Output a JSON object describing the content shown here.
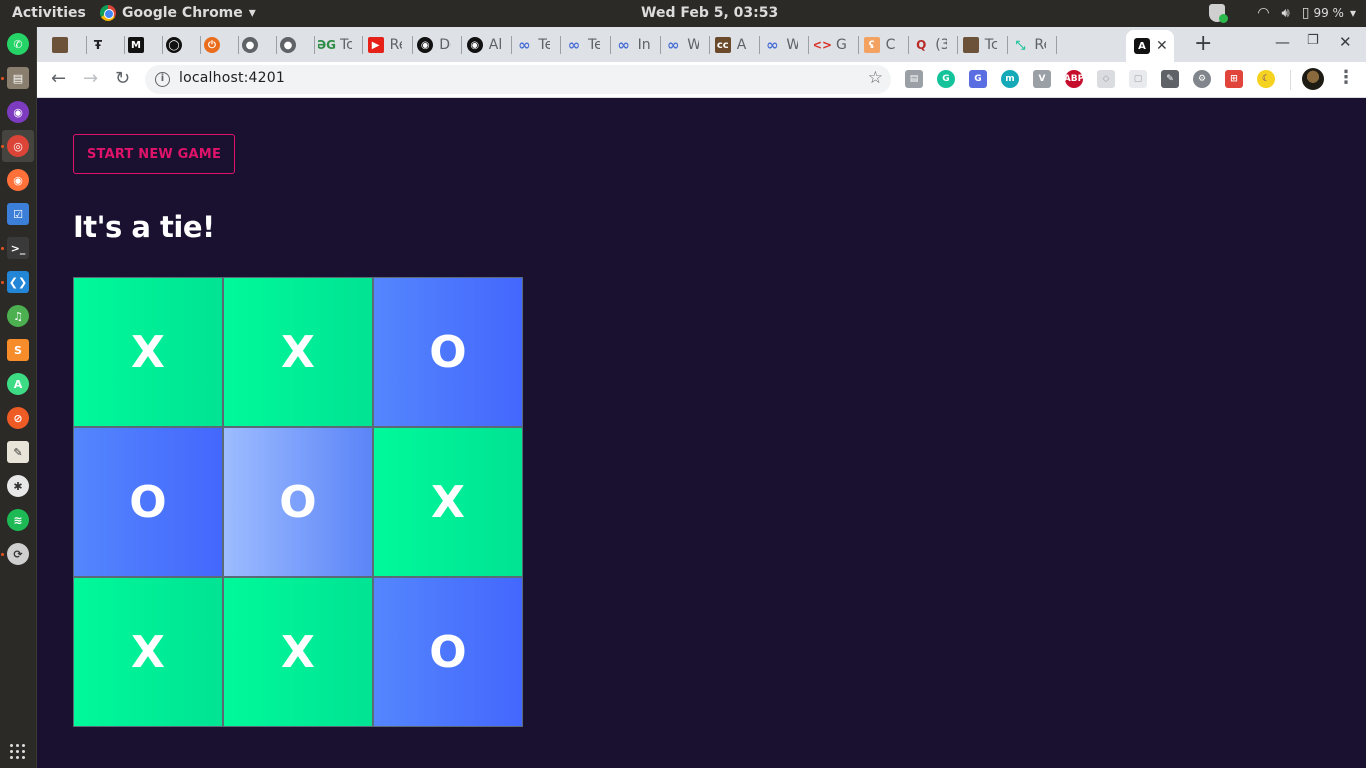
{
  "os": {
    "activities_label": "Activities",
    "app_menu_label": "Google Chrome",
    "app_menu_arrow": "▾",
    "clock": "Wed Feb  5, 03:53",
    "battery": "99 %",
    "tray_arrow": "▾",
    "dock": [
      {
        "name": "whatsapp",
        "color": "#25d366",
        "glyph": "✆"
      },
      {
        "name": "files",
        "color": "#8a7e6e",
        "glyph": "▤"
      },
      {
        "name": "tor-browser",
        "color": "#7d3cbf",
        "glyph": "◉"
      },
      {
        "name": "chrome",
        "color": "#db4437",
        "glyph": "◎"
      },
      {
        "name": "firefox",
        "color": "#ff7139",
        "glyph": "◉"
      },
      {
        "name": "tasks",
        "color": "#3c7fd8",
        "glyph": "☑"
      },
      {
        "name": "terminal",
        "color": "#3a3a3a",
        "glyph": ">_"
      },
      {
        "name": "vscode",
        "color": "#2285d6",
        "glyph": "❮❯"
      },
      {
        "name": "music",
        "color": "#4caf50",
        "glyph": "♫"
      },
      {
        "name": "sublime",
        "color": "#f78c2b",
        "glyph": "S"
      },
      {
        "name": "android-studio",
        "color": "#3ddc84",
        "glyph": "A"
      },
      {
        "name": "postman",
        "color": "#ef5b25",
        "glyph": "⊘"
      },
      {
        "name": "text-editor",
        "color": "#e8e4d8",
        "glyph": "✎"
      },
      {
        "name": "slack",
        "color": "#e8e8e8",
        "glyph": "✱"
      },
      {
        "name": "spotify",
        "color": "#1db954",
        "glyph": "≋"
      },
      {
        "name": "software-updater",
        "color": "#cfcfcf",
        "glyph": "⟳"
      }
    ]
  },
  "browser": {
    "tabs": [
      {
        "label": "",
        "icon": "photo",
        "color": "#6b5238",
        "glyph": ""
      },
      {
        "label": "",
        "icon": "typeface",
        "color": "transparent",
        "glyph": "Ŧ"
      },
      {
        "label": "",
        "icon": "medium",
        "color": "#111111",
        "glyph": "M"
      },
      {
        "label": "",
        "icon": "github",
        "color": "#111111",
        "glyph": "◯"
      },
      {
        "label": "",
        "icon": "power",
        "color": "#e96d1c",
        "glyph": "⏻"
      },
      {
        "label": "",
        "icon": "globe",
        "color": "#5f6368",
        "glyph": "●"
      },
      {
        "label": "",
        "icon": "globe",
        "color": "#5f6368",
        "glyph": "●"
      },
      {
        "label": "Tc",
        "icon": "geeksforgeeks",
        "color": "transparent",
        "glyph": "ƏG"
      },
      {
        "label": "Re",
        "icon": "youtube",
        "color": "#e62117",
        "glyph": "▶"
      },
      {
        "label": "De",
        "icon": "spiral",
        "color": "#111111",
        "glyph": "◉"
      },
      {
        "label": "Al",
        "icon": "spiral",
        "color": "#111111",
        "glyph": "◉"
      },
      {
        "label": "Te",
        "icon": "infinity",
        "color": "transparent",
        "glyph": "∞"
      },
      {
        "label": "Te",
        "icon": "infinity",
        "color": "transparent",
        "glyph": "∞"
      },
      {
        "label": "In",
        "icon": "infinity",
        "color": "transparent",
        "glyph": "∞"
      },
      {
        "label": "W",
        "icon": "infinity",
        "color": "transparent",
        "glyph": "∞"
      },
      {
        "label": "A",
        "icon": "cc",
        "color": "#6b4a2b",
        "glyph": "cc"
      },
      {
        "label": "W",
        "icon": "infinity",
        "color": "transparent",
        "glyph": "∞"
      },
      {
        "label": "G",
        "icon": "code",
        "color": "transparent",
        "glyph": "<>"
      },
      {
        "label": "C",
        "icon": "c-logo",
        "color": "#f4a261",
        "glyph": "ʢ"
      },
      {
        "label": "(3",
        "icon": "quora",
        "color": "transparent",
        "glyph": "Q"
      },
      {
        "label": "Tc",
        "icon": "photo",
        "color": "#6b5238",
        "glyph": ""
      },
      {
        "label": "Re",
        "icon": "compress",
        "color": "transparent",
        "glyph": "⤡"
      }
    ],
    "active_tab": {
      "label": "",
      "icon": "angular",
      "glyph": "A",
      "close": "✕"
    },
    "new_tab": "+",
    "window_controls": {
      "minimize": "—",
      "restore": "❐",
      "close": "✕"
    },
    "nav": {
      "back": "←",
      "forward": "→",
      "reload": "↻"
    },
    "url": "localhost:4201",
    "info_icon": "i",
    "bookmark_star": "☆",
    "extensions": [
      {
        "name": "clipboard",
        "color": "#9aa0a6",
        "glyph": "▤"
      },
      {
        "name": "grammarly",
        "color": "#15c39a",
        "glyph": "G"
      },
      {
        "name": "google-translate",
        "color": "#5b6ee1",
        "glyph": "G"
      },
      {
        "name": "mercury",
        "color": "#16a9b8",
        "glyph": "m"
      },
      {
        "name": "vuejs-devtools",
        "color": "#9aa0a6",
        "glyph": "V"
      },
      {
        "name": "adblock-plus",
        "color": "#c70d2c",
        "glyph": "ABP"
      },
      {
        "name": "privacy-badger",
        "color": "#dadce0",
        "glyph": "◇"
      },
      {
        "name": "disabled-extension",
        "color": "#e8eaed",
        "glyph": "▢"
      },
      {
        "name": "color-picker",
        "color": "#5f6368",
        "glyph": "✎"
      },
      {
        "name": "settings-gear",
        "color": "#80868b",
        "glyph": "⚙"
      },
      {
        "name": "site-map",
        "color": "#e0443a",
        "glyph": "⊞"
      },
      {
        "name": "dark-reader",
        "color": "#f4d21f",
        "glyph": "☾"
      }
    ],
    "menu": "⋮"
  },
  "game": {
    "start_button_label": "START NEW GAME",
    "status": "It's a tie!",
    "board": [
      [
        "X",
        "X",
        "O"
      ],
      [
        "O",
        "O",
        "X"
      ],
      [
        "X",
        "X",
        "O"
      ]
    ],
    "highlighted_cell": [
      1,
      1
    ],
    "colors": {
      "background": "#1a1030",
      "accent": "#e0136a",
      "x_cell": "#00f99a",
      "o_cell": "#4a70fd"
    }
  }
}
